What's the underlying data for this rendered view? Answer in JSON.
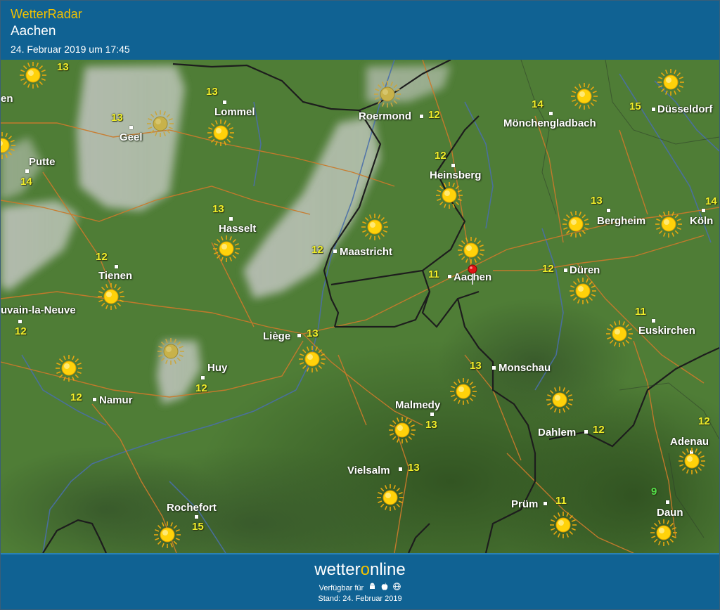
{
  "header": {
    "app_title": "WetterRadar",
    "location": "Aachen",
    "datetime": "24. Februar 2019 um 17:45"
  },
  "map": {
    "places": [
      {
        "name": "Lommel",
        "temp": "13"
      },
      {
        "name": "Geel",
        "temp": "13"
      },
      {
        "name": "Roermond",
        "temp": "12"
      },
      {
        "name": "Mönchengladbach",
        "temp": "14"
      },
      {
        "name": "Düsseldorf",
        "temp": "15"
      },
      {
        "name": "Putte",
        "temp": "14"
      },
      {
        "name": "Heinsberg",
        "temp": "12"
      },
      {
        "name": "Hasselt",
        "temp": "13"
      },
      {
        "name": "Bergheim",
        "temp": "13"
      },
      {
        "name": "Köln",
        "temp": "14"
      },
      {
        "name": "Maastricht",
        "temp": "12"
      },
      {
        "name": "Tienen",
        "temp": "12"
      },
      {
        "name": "Aachen",
        "temp": "11"
      },
      {
        "name": "Düren",
        "temp": "12"
      },
      {
        "name": "Louvain-la-Neuve",
        "temp": "12"
      },
      {
        "name": "Euskirchen",
        "temp": "11"
      },
      {
        "name": "Liège",
        "temp": "13"
      },
      {
        "name": "Huy",
        "temp": "12"
      },
      {
        "name": "Monschau",
        "temp": "13"
      },
      {
        "name": "Namur",
        "temp": "12"
      },
      {
        "name": "Malmedy",
        "temp": "13"
      },
      {
        "name": "Dahlem",
        "temp": "12"
      },
      {
        "name": "Adenau",
        "temp": "12"
      },
      {
        "name": "Vielsalm",
        "temp": "13"
      },
      {
        "name": "Prüm",
        "temp": "11"
      },
      {
        "name": "Daun",
        "temp": "9"
      },
      {
        "name": "Rochefort",
        "temp": "15"
      }
    ],
    "edge_label": "en",
    "top_left_temp": "13"
  },
  "footer": {
    "brand_pre": "wetter",
    "brand_o": "o",
    "brand_post": "nline",
    "available": "Verfügbar für",
    "platform_icons": [
      "android-icon",
      "apple-icon",
      "web-icon"
    ],
    "stand": "Stand: 24. Februar 2019"
  },
  "colors": {
    "header_bg": "#106293",
    "accent": "#f2c200",
    "map_green": "#4c7a34",
    "temp_yellow": "#f1ee2a",
    "temp_green": "#52e04a"
  }
}
